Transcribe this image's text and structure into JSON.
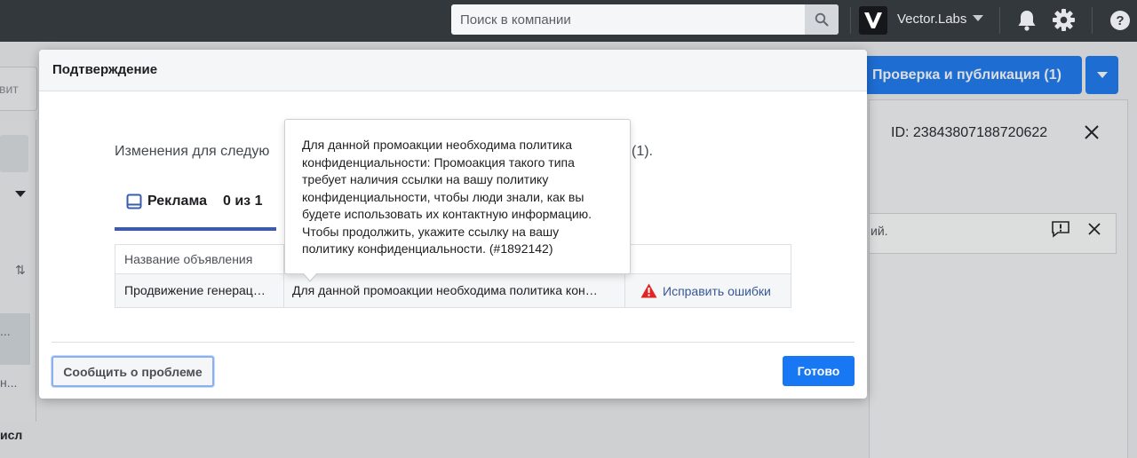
{
  "topbar": {
    "search_placeholder": "Поиск в компании",
    "brand_name": "Vector.Labs",
    "help_glyph": "?"
  },
  "background": {
    "publish_label": "Проверка и публикация (1)",
    "left_button_fragment": "вит",
    "left_row_text_1": "...",
    "left_row_text_2": "н...",
    "left_row_text_3": "исл",
    "record_id": "ID: 23843807188720622",
    "notice_fragment": "ий."
  },
  "modal": {
    "title": "Подтверждение",
    "changes_prefix": "Изменения для следую",
    "changes_suffix": "(1).",
    "tab": {
      "label": "Реклама",
      "count": "0 из 1"
    },
    "table": {
      "headers": [
        "Название объявления",
        "",
        ""
      ],
      "rows": [
        {
          "name": "Продвижение генерац…",
          "issue": "Для данной промоакции необходима политика кон…",
          "action": "Исправить ошибки"
        }
      ]
    },
    "report_button": "Сообщить о проблеме",
    "done_button": "Готово"
  },
  "tooltip": {
    "text": "Для данной промоакции необходима политика конфиденциальности: Промоакция такого типа требует наличия ссылки на вашу политику конфиденциальности, чтобы люди знали, как вы будете использовать их контактную информацию. Чтобы продолжить, укажите ссылку на вашу политику конфиденциальности. (#1892142)"
  },
  "colors": {
    "topbar": "#33383d",
    "accent": "#1877f2",
    "tab_underline": "#3b5cac",
    "error": "#e02525",
    "link": "#365899"
  }
}
